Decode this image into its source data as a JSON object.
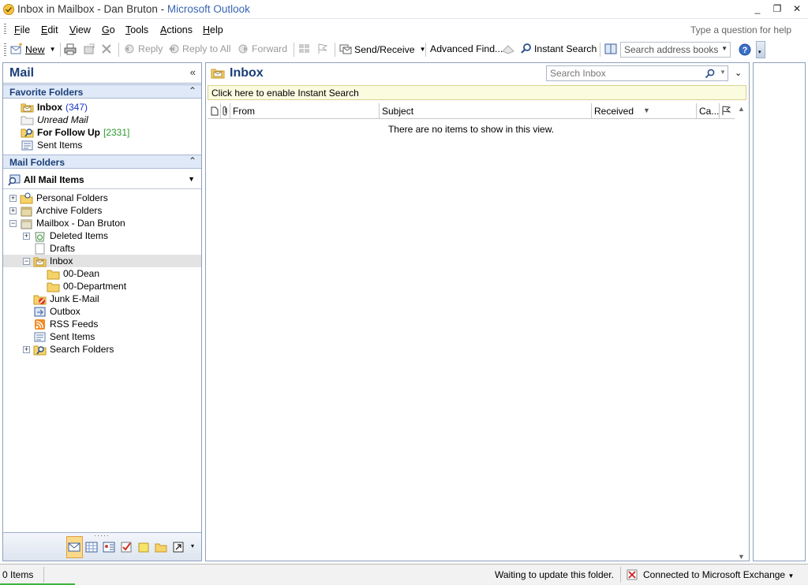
{
  "window": {
    "title_prefix": "Inbox in Mailbox - Dan Bruton - ",
    "app_name": "Microsoft Outlook",
    "minimize": "_",
    "maximize": "❐",
    "close": "✕"
  },
  "menu": {
    "items": [
      {
        "key": "F",
        "rest": "ile"
      },
      {
        "key": "E",
        "rest": "dit"
      },
      {
        "key": "V",
        "rest": "iew"
      },
      {
        "key": "G",
        "rest": "o"
      },
      {
        "key": "T",
        "rest": "ools"
      },
      {
        "key": "A",
        "rest": "ctions"
      },
      {
        "key": "H",
        "rest": "elp"
      }
    ],
    "ask_placeholder": "Type a question for help"
  },
  "toolbar": {
    "new": "New",
    "reply": "Reply",
    "reply_all": "Reply to All",
    "forward": "Forward",
    "send_receive": "Send/Receive",
    "advanced_find": "Advanced Find...",
    "instant_search": "Instant Search",
    "address_placeholder": "Search address books"
  },
  "nav": {
    "title": "Mail",
    "favorites_header": "Favorite Folders",
    "favorites": [
      {
        "label": "Inbox",
        "count": "(347)"
      },
      {
        "label": "Unread Mail"
      },
      {
        "label": "For Follow Up",
        "count": "[2331]"
      },
      {
        "label": "Sent Items"
      }
    ],
    "mail_folders_header": "Mail Folders",
    "all_mail": "All Mail Items",
    "tree": [
      {
        "label": "Personal Folders"
      },
      {
        "label": "Archive Folders"
      },
      {
        "label": "Mailbox - Dan Bruton"
      },
      {
        "label": "Deleted Items"
      },
      {
        "label": "Drafts"
      },
      {
        "label": "Inbox"
      },
      {
        "label": "00-Dean"
      },
      {
        "label": "00-Department"
      },
      {
        "label": "Junk E-Mail"
      },
      {
        "label": "Outbox"
      },
      {
        "label": "RSS Feeds"
      },
      {
        "label": "Sent Items"
      },
      {
        "label": "Search Folders"
      }
    ]
  },
  "content": {
    "title": "Inbox",
    "search_placeholder": "Search Inbox",
    "instant_search_bar": "Click here to enable Instant Search",
    "columns": {
      "from": "From",
      "subject": "Subject",
      "received": "Received",
      "categories": "Ca..."
    },
    "empty_message": "There are no items to show in this view."
  },
  "status": {
    "items": "0 Items",
    "waiting": "Waiting to update this folder.",
    "connection": "Connected to Microsoft Exchange"
  },
  "colors": {
    "header_blue": "#1b3f7a",
    "count_blue": "#1a33cc",
    "count_green": "#2a9a2a",
    "search_bar_yellow": "#fbfbe0"
  }
}
